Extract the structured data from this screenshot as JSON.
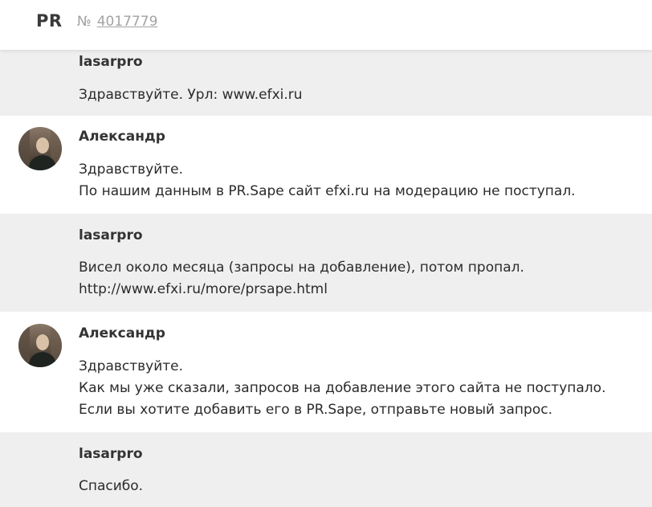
{
  "header": {
    "brand": "PR",
    "ticket_prefix": "№",
    "ticket_number": "4017779"
  },
  "messages": [
    {
      "author": "lasarpro",
      "role": "user",
      "lines": [
        "Здравствуйте. Урл: www.efxi.ru"
      ]
    },
    {
      "author": "Александр",
      "role": "staff",
      "avatar": "avatar-photo",
      "lines": [
        "Здравствуйте.",
        "По нашим данным в PR.Sape сайт efxi.ru на модерацию не поступал."
      ]
    },
    {
      "author": "lasarpro",
      "role": "user",
      "lines": [
        "Висел около месяца (запросы на добавление), потом пропал.",
        "http://www.efxi.ru/more/prsape.html"
      ]
    },
    {
      "author": "Александр",
      "role": "staff",
      "avatar": "avatar-photo",
      "lines": [
        "Здравствуйте.",
        "Как мы уже сказали, запросов на добавление этого сайта не поступало.",
        "Если вы хотите добавить его в PR.Sape, отправьте новый запрос."
      ]
    },
    {
      "author": "lasarpro",
      "role": "user",
      "lines": [
        "Спасибо."
      ]
    }
  ],
  "colors": {
    "user_bg": "#efefef",
    "staff_bg": "#ffffff",
    "muted": "#a3a3a3",
    "text": "#2b2b2b"
  }
}
